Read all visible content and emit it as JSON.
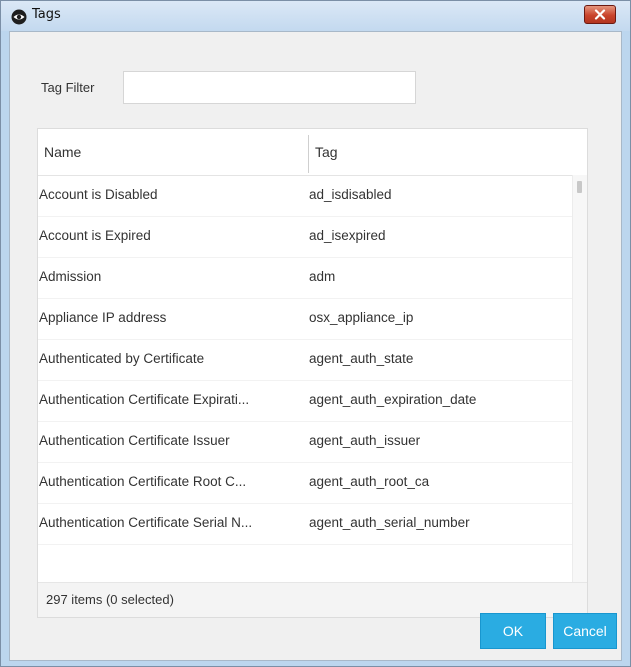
{
  "window": {
    "title": "Tags",
    "icons": {
      "app": "eye-icon",
      "close": "close-icon"
    },
    "close_color": "#c9442c"
  },
  "filter": {
    "label": "Tag Filter",
    "value": "",
    "placeholder": ""
  },
  "table": {
    "columns": [
      "Name",
      "Tag"
    ],
    "rows": [
      {
        "name": "Account is Disabled",
        "tag": "ad_isdisabled"
      },
      {
        "name": "Account is Expired",
        "tag": "ad_isexpired"
      },
      {
        "name": "Admission",
        "tag": "adm"
      },
      {
        "name": "Appliance IP address",
        "tag": "osx_appliance_ip"
      },
      {
        "name": "Authenticated by Certificate",
        "tag": "agent_auth_state"
      },
      {
        "name": "Authentication Certificate Expirati...",
        "tag": "agent_auth_expiration_date"
      },
      {
        "name": "Authentication Certificate Issuer",
        "tag": "agent_auth_issuer"
      },
      {
        "name": "Authentication Certificate Root C...",
        "tag": "agent_auth_root_ca"
      },
      {
        "name": "Authentication Certificate Serial N...",
        "tag": "agent_auth_serial_number"
      }
    ],
    "status": "297 items (0 selected)"
  },
  "buttons": {
    "ok": "OK",
    "cancel": "Cancel",
    "accent_color": "#2aace2"
  }
}
